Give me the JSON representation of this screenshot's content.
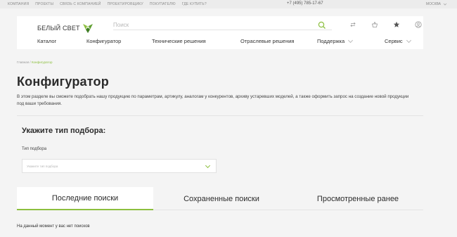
{
  "topbar": {
    "links": [
      "Компания",
      "Проекты",
      "Связь с компанией",
      "Проектировщику",
      "Покупателю",
      "Где купить?"
    ],
    "phone": "+7 (495) 785-17-67",
    "city": "МОСКВА"
  },
  "header": {
    "logo_text": "БЕЛЫЙ СВЕТ",
    "search_placeholder": "Поиск",
    "nav": [
      {
        "label": "Каталог",
        "dropdown": false
      },
      {
        "label": "Конфигуратор",
        "dropdown": false
      },
      {
        "label": "Технические решения",
        "dropdown": false
      },
      {
        "label": "Отраслевые решения",
        "dropdown": false
      },
      {
        "label": "Поддержка",
        "dropdown": true
      },
      {
        "label": "Сервис",
        "dropdown": true
      }
    ]
  },
  "breadcrumb": {
    "home": "Главная",
    "separator": "/",
    "current": "Конфигуратор"
  },
  "page": {
    "title": "Конфигуратор",
    "description": "В этом разделе вы сможете подобрать нашу продукцию по параметрам, артикулу, аналогам у конкурентов, архиву устаревших моделей, а также оформить запрос на создание новой продукции под ваши требования."
  },
  "selector": {
    "heading": "Укажите тип подбора:",
    "field_label": "Тип подбора",
    "placeholder": "Укажите тип подбора"
  },
  "tabs": [
    {
      "label": "Последние поиски",
      "active": true
    },
    {
      "label": "Сохраненные поиски",
      "active": false
    },
    {
      "label": "Просмотренные ранее",
      "active": false
    }
  ],
  "empty_message": "На данный момент у вас нет поисков",
  "colors": {
    "accent": "#8cbf3f",
    "background": "#f4f4f4"
  }
}
